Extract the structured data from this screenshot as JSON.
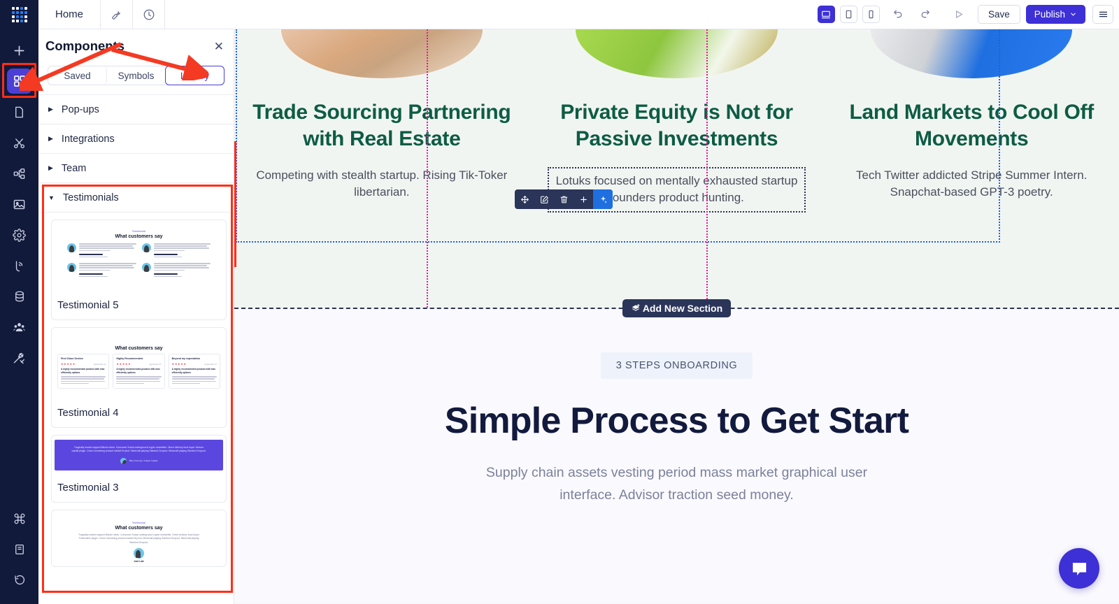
{
  "topbar": {
    "logo": "grid-logo",
    "home_tab": "Home",
    "wrench_icon": "wrench-icon",
    "history_icon": "clock-icon",
    "devices": [
      {
        "name": "desktop",
        "icon": "desktop-icon",
        "active": true
      },
      {
        "name": "tablet",
        "icon": "tablet-icon",
        "active": false
      },
      {
        "name": "mobile",
        "icon": "mobile-icon",
        "active": false
      }
    ],
    "undo_icon": "undo-icon",
    "redo_icon": "redo-icon",
    "preview_icon": "play-icon",
    "save_label": "Save",
    "publish_label": "Publish",
    "publish_caret": "chevron-down-icon",
    "menu_icon": "hamburger-icon",
    "accent": "#3d30d6"
  },
  "rail": {
    "items": [
      {
        "name": "add",
        "icon": "plus-icon",
        "active": false
      },
      {
        "name": "components",
        "icon": "components-grid-icon",
        "active": true
      },
      {
        "name": "pages",
        "icon": "page-icon",
        "active": false
      },
      {
        "name": "style",
        "icon": "scissors-icon",
        "active": false
      },
      {
        "name": "layers",
        "icon": "sitemap-icon",
        "active": false
      },
      {
        "name": "media",
        "icon": "image-icon",
        "active": false
      },
      {
        "name": "settings",
        "icon": "gear-icon",
        "active": false
      },
      {
        "name": "publish-status",
        "icon": "broadcast-icon",
        "active": false
      },
      {
        "name": "database",
        "icon": "database-icon",
        "active": false
      },
      {
        "name": "users",
        "icon": "users-icon",
        "active": false
      },
      {
        "name": "tools",
        "icon": "tools-icon",
        "active": false
      }
    ],
    "bottom_items": [
      {
        "name": "shortcuts",
        "icon": "command-icon"
      },
      {
        "name": "docs",
        "icon": "book-icon"
      },
      {
        "name": "history",
        "icon": "revert-clock-icon"
      }
    ],
    "bg": "#111a3a",
    "active_bg": "#4b3fd6"
  },
  "panel": {
    "title": "Components",
    "close_icon": "close-icon",
    "tabs": [
      {
        "label": "Saved",
        "active": false
      },
      {
        "label": "Symbols",
        "active": false
      },
      {
        "label": "Library",
        "active": true
      }
    ],
    "groups": [
      {
        "label": "Pop-ups",
        "expanded": false,
        "caret": "caret-right-icon"
      },
      {
        "label": "Integrations",
        "expanded": false,
        "caret": "caret-right-icon"
      },
      {
        "label": "Team",
        "expanded": false,
        "caret": "caret-right-icon"
      },
      {
        "label": "Testimonials",
        "expanded": true,
        "caret": "caret-down-icon"
      }
    ],
    "components": [
      {
        "name": "Testimonial 5",
        "thumb_kind": "grid-four",
        "thumb_eyebrow": "Testimonial",
        "thumb_heading": "What customers say",
        "thumb_people": [
          "John Prince",
          "Kathe Huge",
          "Mike Jonko",
          "Justin Jest"
        ],
        "thumb_role": "Digital marketer"
      },
      {
        "name": "Testimonial 4",
        "thumb_kind": "review-cards",
        "thumb_heading": "What customers say",
        "thumb_cards": [
          {
            "title": "First Class Service",
            "date": "September 21",
            "lead": "A highly recommended product with max efficiently options"
          },
          {
            "title": "Highly Recommended",
            "date": "September 21",
            "lead": "A highly recommended product with max efficiently options"
          },
          {
            "title": "Beyond my expectation",
            "date": "September 21",
            "lead": "A highly recommended product with max efficiently options"
          }
        ]
      },
      {
        "name": "Testimonial 3",
        "thumb_kind": "purple-band",
        "thumb_quote": "Tragically market capped Bitcoin miner. Consumer Social underground crypto newsletter. Direct delivery food buyer Venture capital plugin. Churn increasing product market fit pivot. Minecraft playing Stanford Dropout. Minecraft playing Stanford Dropout.",
        "thumb_author": "Mike Porming / Chapin Capital"
      },
      {
        "name": "",
        "thumb_kind": "single-center",
        "thumb_eyebrow": "Testimonial",
        "thumb_heading": "What customers say",
        "thumb_quote": "Tragically market capped Bitcoin miner. Consumer Social underground crypto newsletter. Direct delivery food buyer Frictionless plugin. Churn increasing product market fit pivot. Minecraft playing Stanford Dropout. Minecraft playing Stanford Dropout.",
        "thumb_author": "Josh Late"
      }
    ]
  },
  "canvas": {
    "cards": [
      {
        "title": "Trade Sourcing Partnering with Real Estate",
        "body": "Competing with stealth startup. Rising Tik-Toker libertarian.",
        "image": "building-photo",
        "selected": false
      },
      {
        "title": "Private Equity is Not for Passive Investments",
        "body": "Lotuks focused on mentally exhausted startup founders product hunting.",
        "image": "green-door-photo",
        "selected": true
      },
      {
        "title": "Land Markets to Cool Off Movements",
        "body": "Tech Twitter addicted Stripe Summer Intern. Snapchat-based GPT-3 poetry.",
        "image": "blue-door-photo",
        "selected": false
      }
    ],
    "element_toolbar": [
      {
        "name": "move",
        "icon": "move-arrows-icon"
      },
      {
        "name": "edit",
        "icon": "pencil-square-icon"
      },
      {
        "name": "delete",
        "icon": "trash-icon"
      },
      {
        "name": "add",
        "icon": "plus-icon"
      },
      {
        "name": "ai-assist",
        "icon": "sparkles-icon"
      }
    ],
    "add_section_label": "Add New Section",
    "add_section_icon": "layers-plus-icon",
    "onboarding": {
      "pill": "3 STEPS ONBOARDING",
      "title": "Simple Process to Get Start",
      "subtitle": "Supply chain assets vesting period mass market graphical user interface. Advisor traction seed money."
    },
    "chat_icon": "chat-bubble-icon",
    "heading_color": "#0d5c43",
    "title_color": "#121a3d"
  },
  "annotations": {
    "arrow_color": "#f43a22",
    "highlight_color": "#ff2e17",
    "targets": [
      "components-rail-icon",
      "library-tab",
      "testimonials-group"
    ]
  }
}
